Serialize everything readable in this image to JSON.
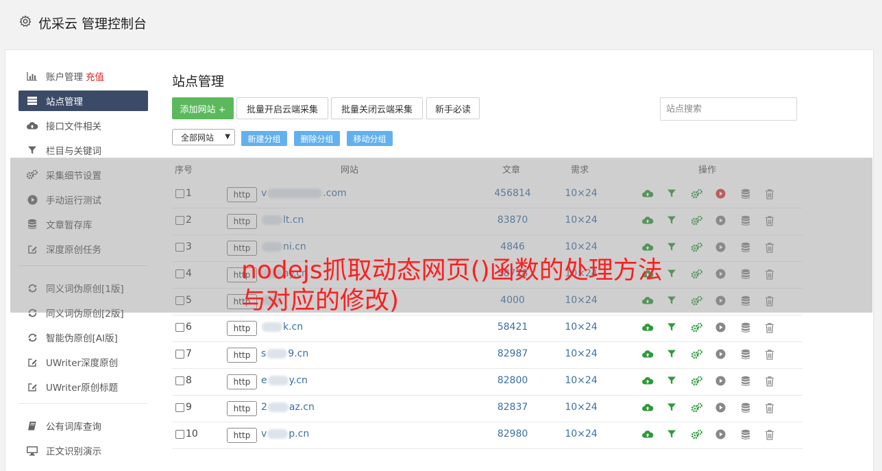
{
  "header": {
    "title": "优采云 管理控制台",
    "icon": "gear-icon"
  },
  "sidebar": {
    "groups": [
      [
        {
          "label": "账户管理",
          "extra": "充值",
          "icon": "bar-chart-icon",
          "active": false
        },
        {
          "label": "站点管理",
          "icon": "server-icon",
          "active": true
        },
        {
          "label": "接口文件相关",
          "icon": "cloud-upload-icon",
          "active": false
        },
        {
          "label": "栏目与关键词",
          "icon": "filter-icon",
          "active": false
        },
        {
          "label": "采集细节设置",
          "icon": "gears-icon",
          "active": false
        },
        {
          "label": "手动运行测试",
          "icon": "play-icon",
          "active": false
        },
        {
          "label": "文章暂存库",
          "icon": "database-icon",
          "active": false
        },
        {
          "label": "深度原创任务",
          "icon": "edit-icon",
          "active": false
        }
      ],
      [
        {
          "label": "同义词伪原创[1版]",
          "icon": "refresh-icon",
          "active": false
        },
        {
          "label": "同义词伪原创[2版]",
          "icon": "refresh-icon",
          "active": false
        },
        {
          "label": "智能伪原创[AI版]",
          "icon": "refresh-icon",
          "active": false
        },
        {
          "label": "UWriter深度原创",
          "icon": "edit-icon",
          "active": false
        },
        {
          "label": "UWriter原创标题",
          "icon": "edit-icon",
          "active": false
        }
      ],
      [
        {
          "label": "公有词库查询",
          "icon": "book-icon",
          "active": false
        },
        {
          "label": "正文识别演示",
          "icon": "monitor-icon",
          "active": false
        }
      ]
    ]
  },
  "main": {
    "title": "站点管理",
    "toolbar": {
      "add_site": "添加网站 +",
      "enable_cloud": "批量开启云端采集",
      "disable_cloud": "批量关闭云端采集",
      "newbie": "新手必读",
      "search_placeholder": "站点搜索"
    },
    "group_select": "全部网站",
    "group_buttons": [
      "新建分组",
      "删除分组",
      "移动分组"
    ],
    "table": {
      "headers": {
        "index": "序号",
        "site": "网站",
        "articles": "文章",
        "demand": "需求",
        "ops": "操作"
      },
      "protocol_label": "http",
      "rows": [
        {
          "index": "1",
          "site_prefix": "v",
          "site_suffix": ".com",
          "articles": "456814",
          "demand": "10×24",
          "play_active": true
        },
        {
          "index": "2",
          "site_prefix": "",
          "site_suffix": "lt.cn",
          "articles": "83870",
          "demand": "10×24",
          "play_active": false
        },
        {
          "index": "3",
          "site_prefix": "",
          "site_suffix": "ni.cn",
          "articles": "4846",
          "demand": "10×24",
          "play_active": false
        },
        {
          "index": "4",
          "site_prefix": "",
          "site_suffix": "ay.cn",
          "articles": "58728",
          "demand": "10×24",
          "play_active": false
        },
        {
          "index": "5",
          "site_prefix": "",
          "site_suffix": "",
          "articles": "4000",
          "demand": "10×24",
          "play_active": false
        },
        {
          "index": "6",
          "site_prefix": "",
          "site_suffix": "k.cn",
          "articles": "58421",
          "demand": "10×24",
          "play_active": false
        },
        {
          "index": "7",
          "site_prefix": "s",
          "site_suffix": "9.cn",
          "articles": "82987",
          "demand": "10×24",
          "play_active": false
        },
        {
          "index": "8",
          "site_prefix": "e",
          "site_suffix": "y.cn",
          "articles": "82800",
          "demand": "10×24",
          "play_active": false
        },
        {
          "index": "9",
          "site_prefix": "2",
          "site_suffix": "az.cn",
          "articles": "82837",
          "demand": "10×24",
          "play_active": false
        },
        {
          "index": "10",
          "site_prefix": "v",
          "site_suffix": "p.cn",
          "articles": "82980",
          "demand": "10×24",
          "play_active": false
        }
      ]
    }
  },
  "overlay_caption": "nodejs抓取动态网页()函数的处理方法与对应的修改)",
  "colors": {
    "accent_green": "#5cb85c",
    "link_blue": "#3a6ea5",
    "sidebar_active": "#3b4a66",
    "caption_red": "#ff1e1e",
    "mini_button": "#62b1ee",
    "op_green": "#2e9a3a"
  }
}
